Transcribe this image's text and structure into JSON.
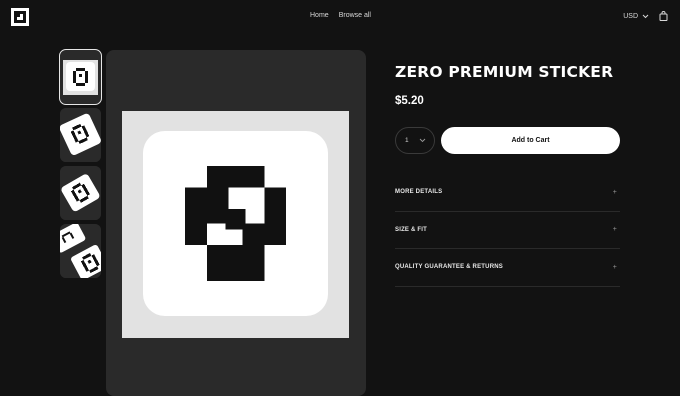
{
  "header": {
    "logo_icon": "pixel-zero-logo-icon",
    "nav": [
      {
        "label": "Home"
      },
      {
        "label": "Browse all"
      }
    ],
    "currency": "USD",
    "bag_icon": "shopping-bag-icon"
  },
  "gallery": {
    "thumbnail_count": 4,
    "selected_index": 0,
    "main_image": "pixel-zero-sticker"
  },
  "product": {
    "title": "ZERO PREMIUM STICKER",
    "price": "$5.20",
    "quantity": "1",
    "add_to_cart": "Add to Cart",
    "accordion": [
      {
        "label": "MORE DETAILS"
      },
      {
        "label": "SIZE & FIT"
      },
      {
        "label": "QUALITY GUARANTEE & RETURNS"
      }
    ]
  },
  "colors": {
    "background": "#121212",
    "panel": "#2a2a2a",
    "button": "#ffffff"
  }
}
